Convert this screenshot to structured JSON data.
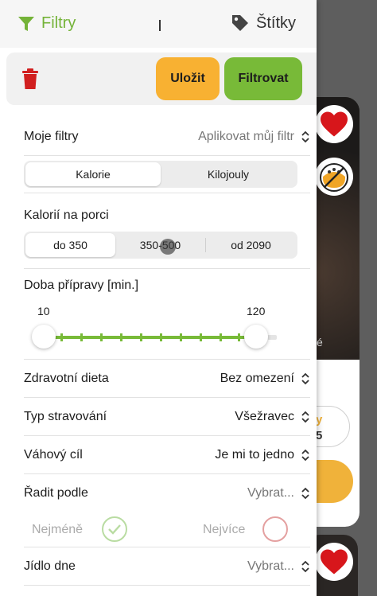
{
  "colors": {
    "accent_green": "#78ba38",
    "save_orange": "#f8b132",
    "trash_red": "#d11f1f",
    "check_green": "#b9dca2",
    "cross_red": "#e4a0a0"
  },
  "tabs": {
    "filters": {
      "label": "Filtry",
      "icon": "filter-icon"
    },
    "tags": {
      "label": "Štítky",
      "icon": "tag-icon"
    }
  },
  "actions": {
    "delete_icon": "trash-icon",
    "save_label": "Uložit",
    "filter_label": "Filtrovat"
  },
  "my_filters": {
    "label": "Moje filtry",
    "value": "Aplikovat můj filtr"
  },
  "energy_unit": {
    "options": [
      "Kalorie",
      "Kilojouly"
    ],
    "selected": "Kalorie"
  },
  "calories_per_portion": {
    "label": "Kalorií na porci",
    "options": [
      "do 350",
      "350-500",
      "od 2090"
    ]
  },
  "prep_time": {
    "label": "Doba přípravy [min.]",
    "min_value": "10",
    "max_value": "120"
  },
  "health_diet": {
    "label": "Zdravotní dieta",
    "value": "Bez omezení"
  },
  "eating_type": {
    "label": "Typ stravování",
    "value": "Všežravec"
  },
  "weight_goal": {
    "label": "Váhový cíl",
    "value": "Je mi to jedno"
  },
  "sort_by": {
    "label": "Řadit podle",
    "value": "Vybrat..."
  },
  "sort_order": {
    "least": "Nejméně",
    "most": "Nejvíce"
  },
  "meal_of_day": {
    "label": "Jídlo dne",
    "value": "Vybrat..."
  },
  "background": {
    "partial_text": "é",
    "pill_top": "y",
    "pill_bottom": "5"
  }
}
